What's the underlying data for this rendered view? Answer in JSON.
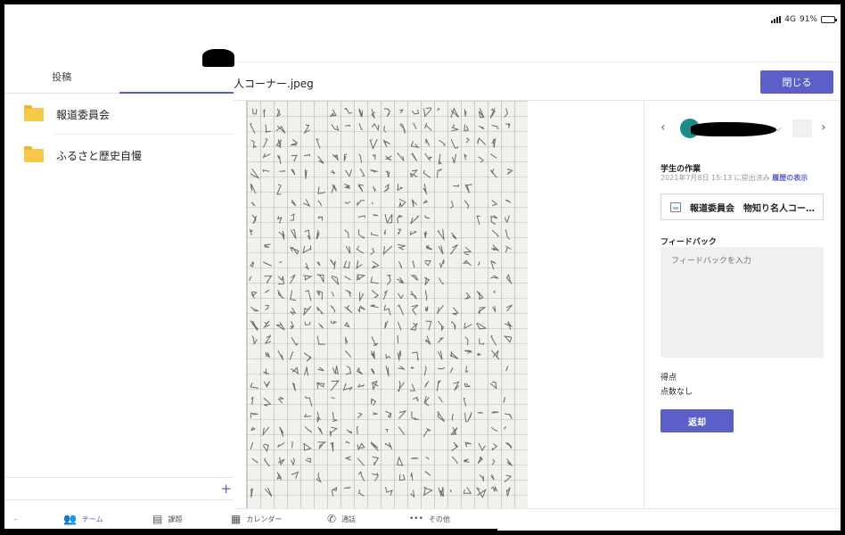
{
  "status_bar": {
    "network": "4G",
    "battery_text": "91%",
    "battery_level": 0.91
  },
  "left_pane": {
    "tabs": [
      {
        "label": "投稿",
        "active": false
      },
      {
        "label": "",
        "active": true
      }
    ],
    "channels": [
      {
        "label": "報道委員会",
        "icon": "folder-icon",
        "color": "#f7c948"
      },
      {
        "label": "ふるさと歴史自慢",
        "icon": "folder-icon",
        "color": "#f7c948"
      }
    ],
    "add_symbol": "+"
  },
  "viewer": {
    "file_title": "人コーナー.jpeg",
    "close_label": "閉じる",
    "accent": "#5b5fc7"
  },
  "review": {
    "prev_arrow": "‹",
    "next_arrow": "›",
    "dropdown_glyph": "⌵",
    "student_work_label": "学生の作業",
    "submitted_text": "2021年7月8日 15:13 に提出済み",
    "history_link": "履歴の表示",
    "attachment_name": "報道委員会　物知り名人コー…",
    "feedback_label": "フィードバック",
    "feedback_placeholder": "フィードバックを入力",
    "points_label": "得点",
    "points_value": "点数なし",
    "return_label": "返却"
  },
  "bottom_nav": {
    "leading_mark": "-",
    "items": [
      {
        "icon": "teams-icon",
        "glyph": "👥",
        "label": "チーム",
        "active": true
      },
      {
        "icon": "assignments-icon",
        "glyph": "▤",
        "label": "課題",
        "active": false
      },
      {
        "icon": "calendar-icon",
        "glyph": "▦",
        "label": "カレンダー",
        "active": false
      },
      {
        "icon": "phone-icon",
        "glyph": "✆",
        "label": "通話",
        "active": false
      },
      {
        "icon": "more-icon",
        "glyph": "•••",
        "label": "その他",
        "active": false
      }
    ]
  }
}
